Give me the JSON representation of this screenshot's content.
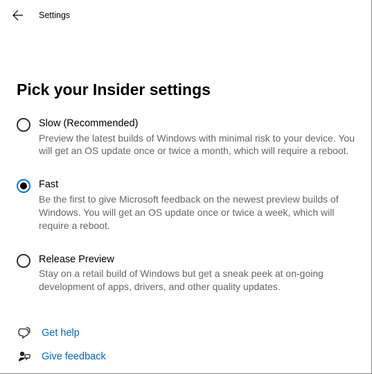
{
  "header": {
    "title": "Settings"
  },
  "page": {
    "title": "Pick your Insider settings"
  },
  "options": [
    {
      "label": "Slow (Recommended)",
      "desc": "Preview the latest builds of Windows with minimal risk to your device. You will get an OS update once or twice a month, which will require a reboot.",
      "selected": false
    },
    {
      "label": "Fast",
      "desc": "Be the first to give Microsoft feedback on the newest preview builds of Windows. You will get an OS update once or twice a week, which will require a reboot.",
      "selected": true
    },
    {
      "label": "Release Preview",
      "desc": "Stay on a retail build of Windows but get a sneak peek at on-going development of apps, drivers, and other quality updates.",
      "selected": false
    }
  ],
  "links": {
    "help": "Get help",
    "feedback": "Give feedback"
  },
  "colors": {
    "accent": "#0078d7",
    "link": "#0067c0"
  }
}
